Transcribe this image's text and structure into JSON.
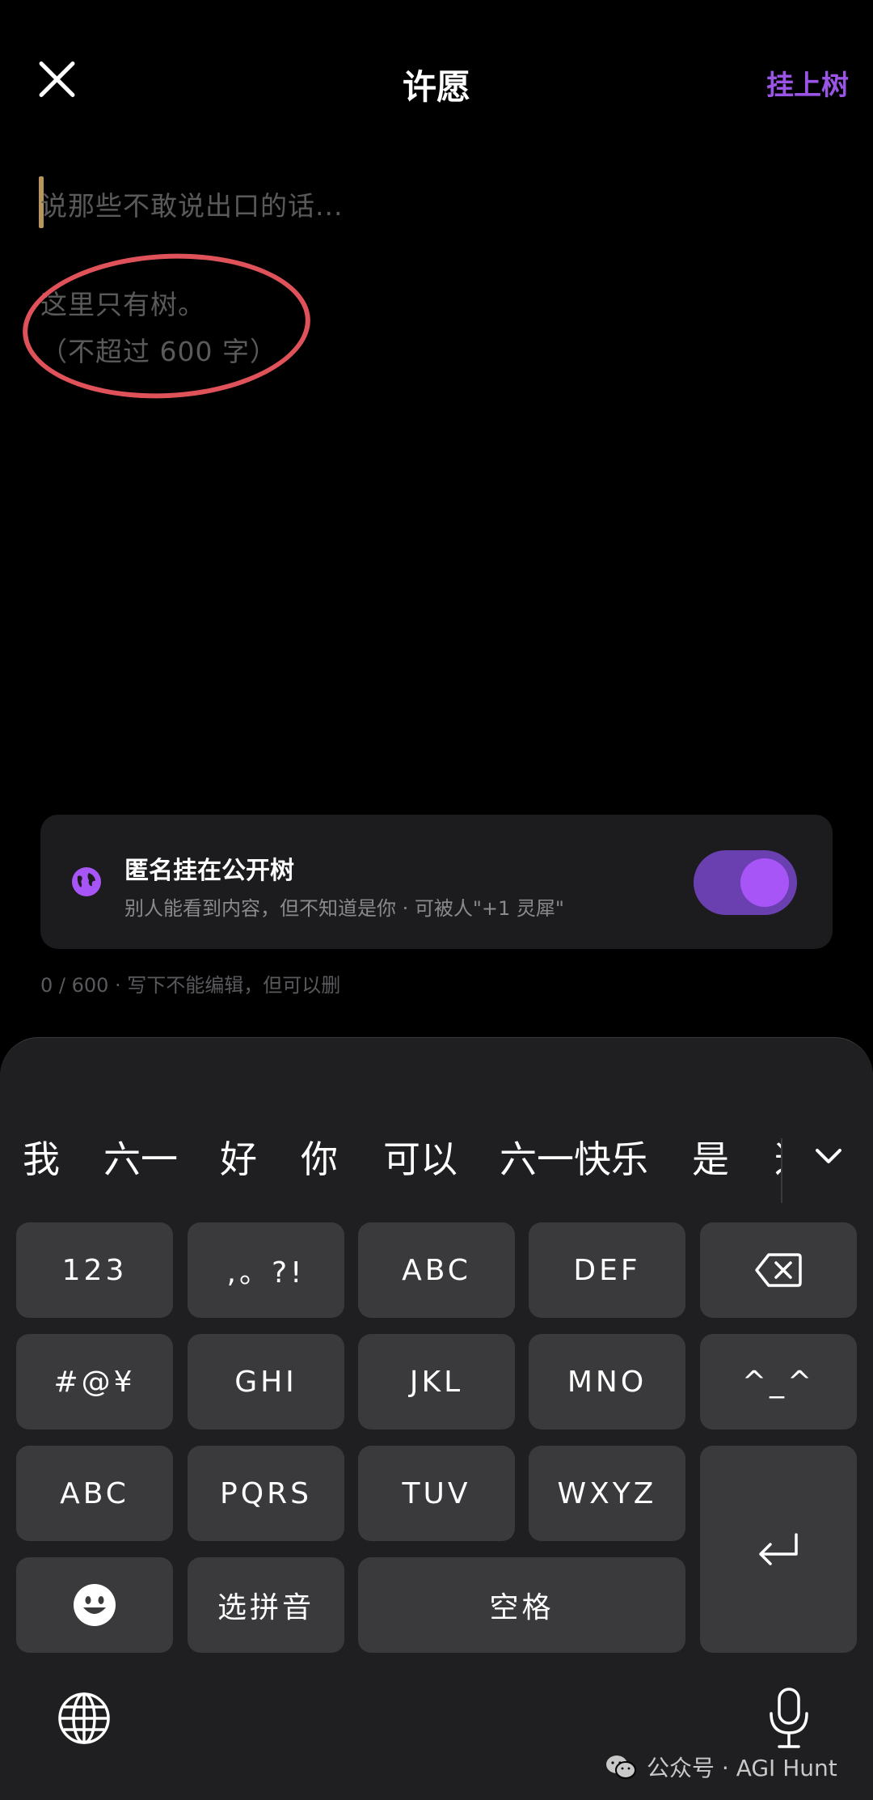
{
  "header": {
    "title": "许愿",
    "submit_label": "挂上树"
  },
  "editor": {
    "placeholder": "说那些不敢说出口的话...",
    "hint_line1": "这里只有树。",
    "hint_line2": "（不超过 600 字）"
  },
  "anonymous": {
    "title": "匿名挂在公开树",
    "subtitle": "别人能看到内容，但不知道是你 · 可被人\"+1 灵犀\"",
    "enabled": true,
    "accent": "#a855f7"
  },
  "counter": "0 / 600 · 写下不能编辑，但可以删",
  "keyboard": {
    "candidates": [
      "我",
      "六一",
      "好",
      "你",
      "可以",
      "六一快乐",
      "是",
      "这"
    ],
    "keys": {
      "num": "123",
      "punct": ",。?!",
      "abc1": "ABC",
      "def": "DEF",
      "symbols": "#@¥",
      "ghi": "GHI",
      "jkl": "JKL",
      "mno": "MNO",
      "kaomoji": "^_^",
      "abc2": "ABC",
      "pqrs": "PQRS",
      "tuv": "TUV",
      "wxyz": "WXYZ",
      "pinyin": "选拼音",
      "space": "空格"
    }
  },
  "watermark": "公众号 · AGI Hunt"
}
